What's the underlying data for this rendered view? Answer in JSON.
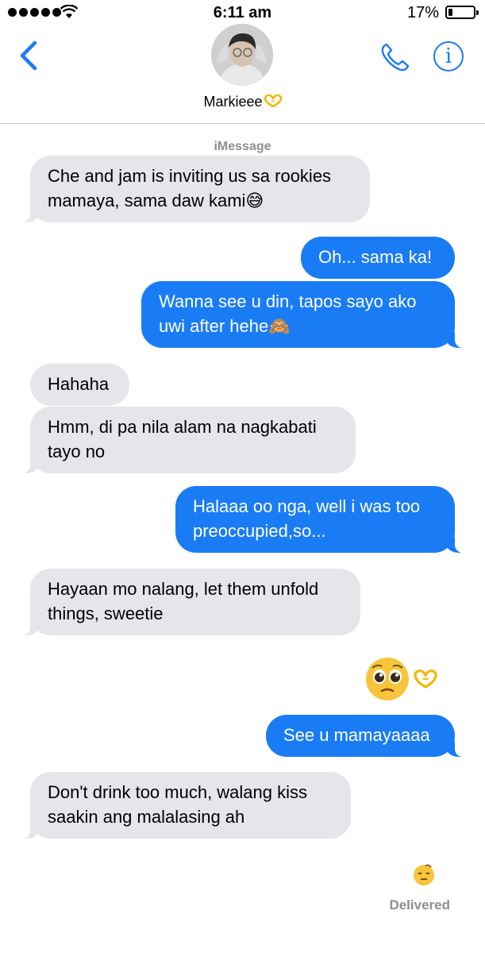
{
  "status_bar": {
    "time": "6:11 am",
    "battery": "17%",
    "battery_level": 0.17
  },
  "header": {
    "contact_name": "Markieee",
    "contact_emoji": "yellow-heart-hands"
  },
  "chat": {
    "service_label": "iMessage",
    "messages": [
      {
        "direction": "incoming",
        "text": "Che and jam is inviting us sa rookies mamaya, sama daw kami😅"
      },
      {
        "direction": "outgoing",
        "text": "Oh... sama ka!"
      },
      {
        "direction": "outgoing",
        "text": "Wanna see u din, tapos sayo ako uwi after hehe🙈"
      },
      {
        "direction": "incoming",
        "text": "Hahaha"
      },
      {
        "direction": "incoming",
        "text": "Hmm, di pa nila alam na nagkabati tayo no"
      },
      {
        "direction": "outgoing",
        "text": "Halaaa oo nga, well i was too preoccupied,so..."
      },
      {
        "direction": "incoming",
        "text": "Hayaan mo nalang, let them unfold things, sweetie"
      },
      {
        "direction": "outgoing",
        "text": "See u mamayaaaa"
      },
      {
        "direction": "incoming",
        "text": "Don't drink too much, walang kiss saakin ang malalasing ah"
      }
    ],
    "outgoing_emoji_message": [
      "pleading-face",
      "heart-hands"
    ],
    "status_emoji": "sleepy-face",
    "delivered_label": "Delivered"
  },
  "colors": {
    "outgoing_bubble": "#1a7cf5",
    "incoming_bubble": "#e5e5ea",
    "accent": "#1a7cf5"
  }
}
